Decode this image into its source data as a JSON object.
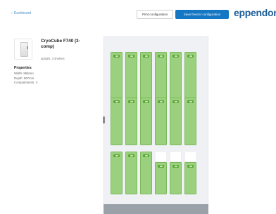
{
  "header": {
    "back_label": "Dashboard",
    "print_button": "Print configuration",
    "save_button": "Save freezer configuration",
    "brand": "eppendorf"
  },
  "product": {
    "name": "CryoCube F740 (3-comp)",
    "subtitle": "upright, 3 shelves"
  },
  "properties": {
    "title": "Properties",
    "items": [
      "Width: 865mm",
      "Depth: 597mm",
      "Compartments: 3"
    ]
  },
  "colors": {
    "accent": "#1577c4",
    "brand": "#1e5e98",
    "rack_fill": "#9bd17e",
    "rack_tab": "#5ea63a",
    "freezer_bg": "#eff1f4",
    "freezer_base": "#9aa1a8"
  },
  "icons": {
    "back": "chevron-left-icon",
    "product": "freezer-icon",
    "rack_handle": "rack-handle-icon"
  }
}
